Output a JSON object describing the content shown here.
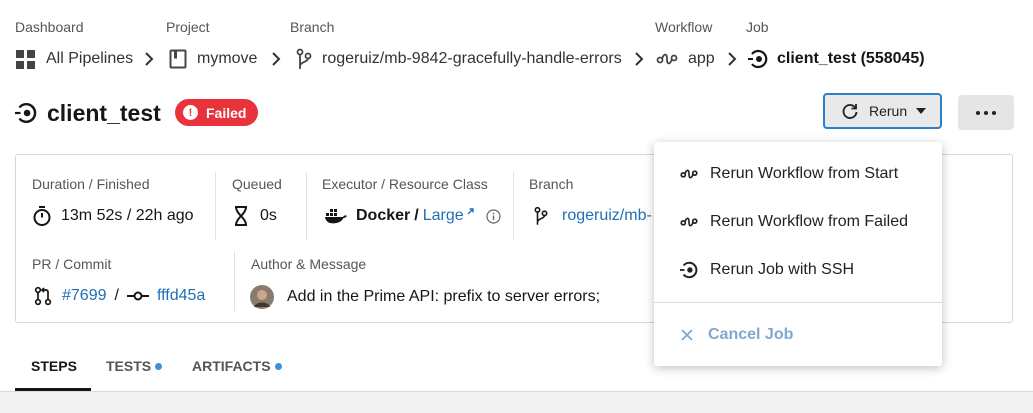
{
  "breadcrumb": {
    "dashboard": {
      "label": "Dashboard",
      "value": "All Pipelines"
    },
    "project": {
      "label": "Project",
      "value": "mymove"
    },
    "branch": {
      "label": "Branch",
      "value": "rogeruiz/mb-9842-gracefully-handle-errors"
    },
    "workflow": {
      "label": "Workflow",
      "value": "app"
    },
    "job": {
      "label": "Job",
      "value": "client_test (558045)"
    }
  },
  "header": {
    "title": "client_test",
    "status": "Failed",
    "status_color": "#e8323c",
    "rerun_label": "Rerun",
    "more_icon": "ellipsis-icon"
  },
  "details": {
    "duration": {
      "label": "Duration / Finished",
      "value": "13m 52s / 22h ago"
    },
    "queued": {
      "label": "Queued",
      "value": "0s"
    },
    "executor": {
      "label": "Executor / Resource Class",
      "executor": "Docker",
      "separator": "/",
      "resource_class": "Large"
    },
    "branch": {
      "label": "Branch",
      "value": "rogeruiz/mb-"
    },
    "pr_commit": {
      "label": "PR / Commit",
      "pr": "#7699",
      "separator": "/",
      "commit": "fffd45a"
    },
    "author": {
      "label": "Author & Message",
      "message": "Add in the Prime API: prefix to server errors;"
    }
  },
  "tabs": [
    {
      "label": "STEPS",
      "active": true,
      "dot": false
    },
    {
      "label": "TESTS",
      "active": false,
      "dot": true
    },
    {
      "label": "ARTIFACTS",
      "active": false,
      "dot": true
    }
  ],
  "rerun_menu": {
    "items": [
      {
        "label": "Rerun Workflow from Start",
        "icon": "workflow-icon"
      },
      {
        "label": "Rerun Workflow from Failed",
        "icon": "workflow-icon"
      },
      {
        "label": "Rerun Job with SSH",
        "icon": "job-icon"
      }
    ],
    "cancel": {
      "label": "Cancel Job",
      "icon": "close-icon"
    }
  },
  "colors": {
    "link": "#1f6fb5",
    "accent_border": "#2c80c8",
    "tab_dot": "#3d8fd6",
    "cancel": "#7fa9cf"
  }
}
